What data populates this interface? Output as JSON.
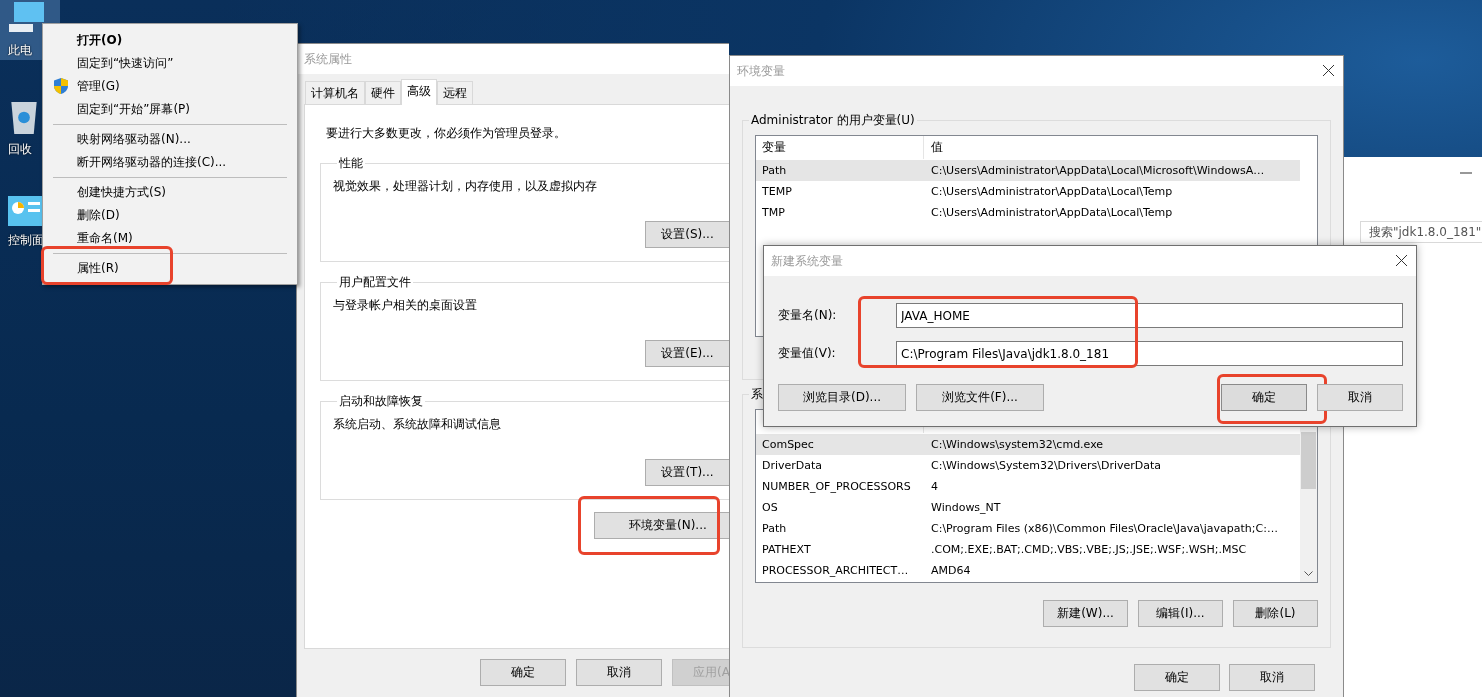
{
  "desktop_icons": [
    {
      "kind": "computer",
      "label": "此电",
      "selected": true
    },
    {
      "kind": "recycle_bin",
      "label": "回收",
      "selected": false
    },
    {
      "kind": "control_panel",
      "label": "控制面",
      "selected": false
    }
  ],
  "context_menu": {
    "groups": [
      [
        {
          "label": "打开(O)",
          "default": true,
          "elevated": false,
          "highlighted": false
        },
        {
          "label": "固定到“快速访问”",
          "default": false,
          "elevated": false,
          "highlighted": false
        },
        {
          "label": "管理(G)",
          "default": false,
          "elevated": true,
          "highlighted": false
        },
        {
          "label": "固定到“开始”屏幕(P)",
          "default": false,
          "elevated": false,
          "highlighted": false
        }
      ],
      [
        {
          "label": "映射网络驱动器(N)...",
          "default": false,
          "elevated": false,
          "highlighted": false
        },
        {
          "label": "断开网络驱动器的连接(C)...",
          "default": false,
          "elevated": false,
          "highlighted": false
        }
      ],
      [
        {
          "label": "创建快捷方式(S)",
          "default": false,
          "elevated": false,
          "highlighted": false
        },
        {
          "label": "删除(D)",
          "default": false,
          "elevated": false,
          "highlighted": false
        },
        {
          "label": "重命名(M)",
          "default": false,
          "elevated": false,
          "highlighted": false
        }
      ],
      [
        {
          "label": "属性(R)",
          "default": false,
          "elevated": false,
          "highlighted": true
        }
      ]
    ]
  },
  "system_properties": {
    "title": "系统属性",
    "tabs": [
      {
        "label": "计算机名",
        "selected": false
      },
      {
        "label": "硬件",
        "selected": false
      },
      {
        "label": "高级",
        "selected": true
      },
      {
        "label": "远程",
        "selected": false
      }
    ],
    "notice": "要进行大多数更改，你必须作为管理员登录。",
    "groups": [
      {
        "legend": "性能",
        "description": "视觉效果，处理器计划，内存使用，以及虚拟内存",
        "button": "设置(S)..."
      },
      {
        "legend": "用户配置文件",
        "description": "与登录帐户相关的桌面设置",
        "button": "设置(E)..."
      },
      {
        "legend": "启动和故障恢复",
        "description": "系统启动、系统故障和调试信息",
        "button": "设置(T)..."
      }
    ],
    "env_button": {
      "label": "环境变量(N)...",
      "highlighted": true
    },
    "buttons": [
      {
        "label": "确定",
        "disabled": false
      },
      {
        "label": "取消",
        "disabled": false
      },
      {
        "label": "应用(A",
        "disabled": true
      }
    ]
  },
  "environment_variables": {
    "title": "环境变量",
    "user_group": {
      "legend": "Administrator 的用户变量(U)",
      "columns": [
        "变量",
        "值"
      ],
      "rows": [
        {
          "name": "Path",
          "value": "C:\\Users\\Administrator\\AppData\\Local\\Microsoft\\WindowsA…",
          "selected": true
        },
        {
          "name": "TEMP",
          "value": "C:\\Users\\Administrator\\AppData\\Local\\Temp",
          "selected": false
        },
        {
          "name": "TMP",
          "value": "C:\\Users\\Administrator\\AppData\\Local\\Temp",
          "selected": false
        }
      ]
    },
    "system_group": {
      "legend": "系",
      "rows": [
        {
          "name": "ComSpec",
          "value": "C:\\Windows\\system32\\cmd.exe",
          "selected": true
        },
        {
          "name": "DriverData",
          "value": "C:\\Windows\\System32\\Drivers\\DriverData",
          "selected": false
        },
        {
          "name": "NUMBER_OF_PROCESSORS",
          "value": "4",
          "selected": false
        },
        {
          "name": "OS",
          "value": "Windows_NT",
          "selected": false
        },
        {
          "name": "Path",
          "value": "C:\\Program Files (x86)\\Common Files\\Oracle\\Java\\javapath;C:…",
          "selected": false
        },
        {
          "name": "PATHEXT",
          "value": ".COM;.EXE;.BAT;.CMD;.VBS;.VBE;.JS;.JSE;.WSF;.WSH;.MSC",
          "selected": false
        },
        {
          "name": "PROCESSOR_ARCHITECT…",
          "value": "AMD64",
          "selected": false
        }
      ],
      "buttons": [
        "新建(W)...",
        "编辑(I)...",
        "删除(L)"
      ]
    },
    "buttons": [
      "确定",
      "取消"
    ]
  },
  "new_variable_dialog": {
    "title": "新建系统变量",
    "fields": {
      "highlighted": true,
      "items": [
        {
          "label": "变量名(N):",
          "value": "JAVA_HOME"
        },
        {
          "label": "变量值(V):",
          "value": "C:\\Program Files\\Java\\jdk1.8.0_181"
        }
      ]
    },
    "browse_buttons": [
      "浏览目录(D)...",
      "浏览文件(F)..."
    ],
    "buttons": [
      {
        "label": "确定",
        "highlighted": true
      },
      {
        "label": "取消",
        "highlighted": false
      }
    ]
  },
  "background_window": {
    "search": {
      "placeholder": "搜索\"jdk1.8.0_181\""
    }
  }
}
